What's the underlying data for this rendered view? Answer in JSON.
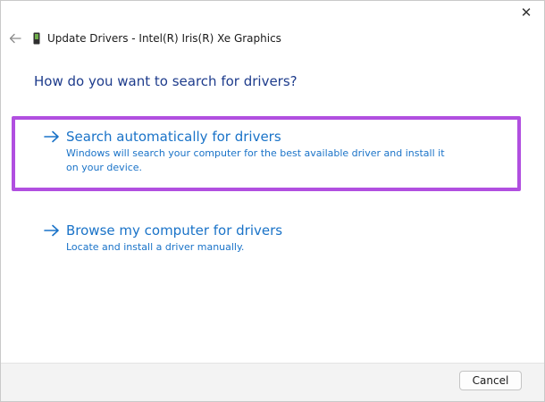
{
  "window": {
    "title": "Update Drivers - Intel(R) Iris(R) Xe Graphics",
    "close_glyph": "✕",
    "back_icon": "back-arrow-icon",
    "device_icon": "display-adapter-icon"
  },
  "question": "How do you want to search for drivers?",
  "options": [
    {
      "title": "Search automatically for drivers",
      "description": "Windows will search your computer for the best available driver and install it on your device.",
      "highlighted": true,
      "icon": "arrow-right-icon"
    },
    {
      "title": "Browse my computer for drivers",
      "description": "Locate and install a driver manually.",
      "highlighted": false,
      "icon": "arrow-right-icon"
    }
  ],
  "footer": {
    "cancel_label": "Cancel"
  },
  "colors": {
    "link_blue": "#1a73c8",
    "heading_blue": "#1e3c8c",
    "highlight_purple": "#b14fe0",
    "footer_bg": "#f3f3f3"
  }
}
